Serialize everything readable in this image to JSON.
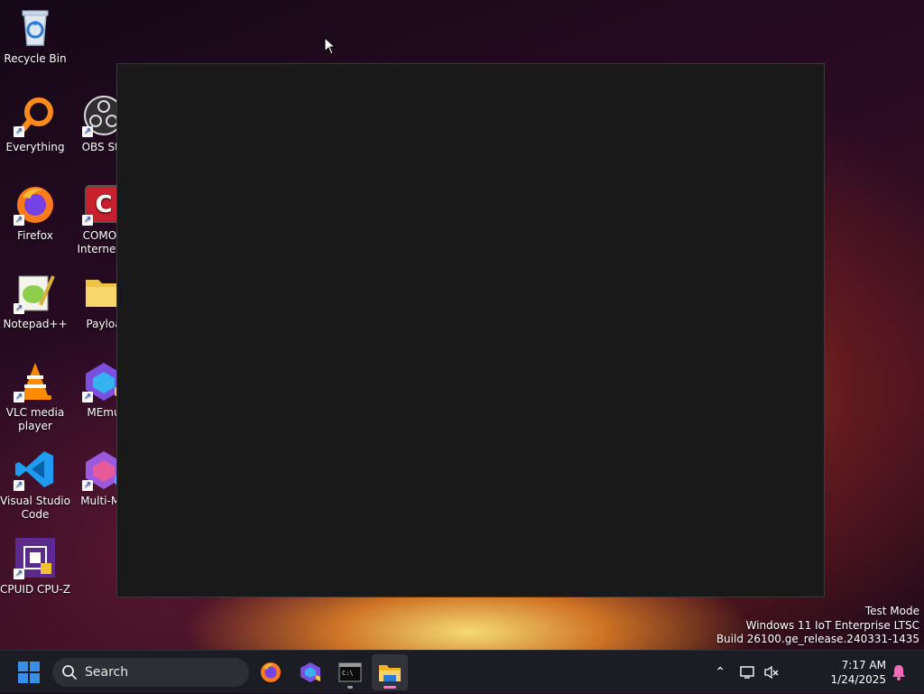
{
  "desktop": {
    "icons": [
      {
        "label": "Recycle Bin"
      },
      {
        "label": "Everything"
      },
      {
        "label": "OBS Stu"
      },
      {
        "label": "Firefox"
      },
      {
        "label": "COMOD Internet S"
      },
      {
        "label": "Notepad++"
      },
      {
        "label": "Payloa"
      },
      {
        "label": "VLC media player"
      },
      {
        "label": "MEmu"
      },
      {
        "label": "Visual Studio Code"
      },
      {
        "label": "Multi-ME"
      },
      {
        "label": "CPUID CPU-Z"
      }
    ]
  },
  "watermark": {
    "line1": "Test Mode",
    "line2": "Windows 11 IoT Enterprise LTSC",
    "line3": "Build 26100.ge_release.240331-1435"
  },
  "taskbar": {
    "search_placeholder": "Search",
    "pinned": [
      "firefox-icon",
      "memu-icon",
      "terminal-icon",
      "file-explorer-icon"
    ],
    "clock_time": "7:17 AM",
    "clock_date": "1/24/2025"
  },
  "colors": {
    "accent_blue": "#3a8ee6",
    "taskbar_bg": "#1c1c24",
    "window_bg": "#191919"
  }
}
